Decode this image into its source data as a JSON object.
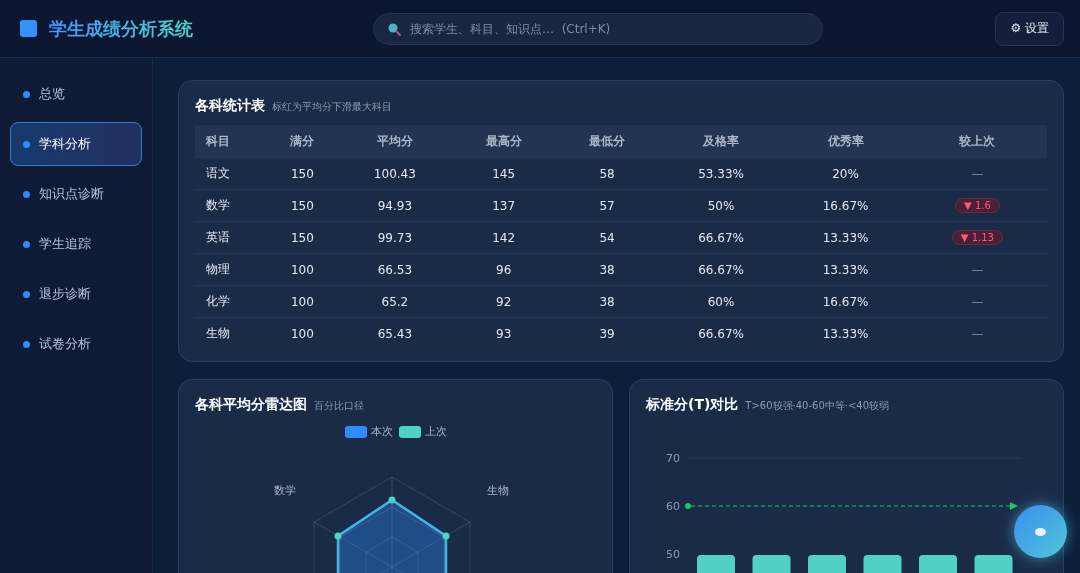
{
  "app": {
    "title": "学生成绩分析系统"
  },
  "search": {
    "placeholder": "搜索学生、科目、知识点…  (Ctrl+K)"
  },
  "settings_button": {
    "icon": "⚙",
    "label": "设置"
  },
  "sidebar": {
    "items": [
      {
        "label": "总览",
        "selected": false
      },
      {
        "label": "学科分析",
        "selected": true
      },
      {
        "label": "知识点诊断",
        "selected": false
      },
      {
        "label": "学生追踪",
        "selected": false
      },
      {
        "label": "退步诊断",
        "selected": false
      },
      {
        "label": "试卷分析",
        "selected": false
      }
    ]
  },
  "stats_table": {
    "title": "各科统计表",
    "subtitle": "标红为平均分下滑最大科目",
    "columns": [
      "科目",
      "满分",
      "平均分",
      "最高分",
      "最低分",
      "及格率",
      "优秀率",
      "较上次"
    ],
    "rows": [
      {
        "cells": [
          "语文",
          "150",
          "100.43",
          "145",
          "58",
          "53.33%",
          "20%"
        ],
        "change": {
          "kind": "none",
          "text": "—"
        }
      },
      {
        "cells": [
          "数学",
          "150",
          "94.93",
          "137",
          "57",
          "50%",
          "16.67%"
        ],
        "change": {
          "kind": "down",
          "text": "▼ 1.6"
        }
      },
      {
        "cells": [
          "英语",
          "150",
          "99.73",
          "142",
          "54",
          "66.67%",
          "13.33%"
        ],
        "change": {
          "kind": "down",
          "text": "▼ 1.13"
        }
      },
      {
        "cells": [
          "物理",
          "100",
          "66.53",
          "96",
          "38",
          "66.67%",
          "13.33%"
        ],
        "change": {
          "kind": "none",
          "text": "—"
        }
      },
      {
        "cells": [
          "化学",
          "100",
          "65.2",
          "92",
          "38",
          "60%",
          "16.67%"
        ],
        "change": {
          "kind": "none",
          "text": "—"
        }
      },
      {
        "cells": [
          "生物",
          "100",
          "65.43",
          "93",
          "39",
          "66.67%",
          "13.33%"
        ],
        "change": {
          "kind": "none",
          "text": "—"
        }
      }
    ]
  },
  "radar_card": {
    "title": "各科平均分雷达图",
    "subtitle": "百分比口径",
    "legend": [
      {
        "label": "本次",
        "color": "#2f8cff"
      },
      {
        "label": "上次",
        "color": "#4fd1c5"
      }
    ],
    "axis_labels": [
      "数学",
      "生物"
    ]
  },
  "tscore_card": {
    "title": "标准分(T)对比",
    "subtitle": "T>60较强·40-60中等·<40较弱",
    "chart_data": {
      "type": "bar",
      "values": [
        49.8,
        49.8,
        49.8,
        49.8,
        49.8,
        49.8
      ],
      "ylim": [
        40,
        70
      ],
      "yticks": [
        50,
        60,
        70
      ],
      "ref_lines": [
        {
          "axis": "y",
          "value": 60
        }
      ]
    }
  }
}
